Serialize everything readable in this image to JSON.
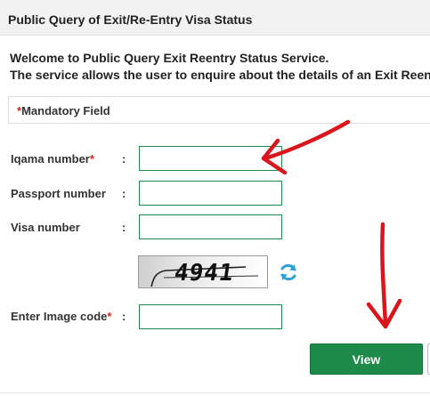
{
  "header": {
    "title": "Public Query of Exit/Re-Entry Visa Status"
  },
  "intro": {
    "line1": "Welcome to Public Query Exit Reentry Status Service.",
    "line2": "The service allows the user to enquire about the details of an Exit Reentry v"
  },
  "mandatory": {
    "asterisk": "*",
    "label": "Mandatory Field"
  },
  "form": {
    "iqama": {
      "label": "Iqama number",
      "required": "*",
      "colon": ":",
      "value": ""
    },
    "passport": {
      "label": "Passport number",
      "colon": ":",
      "value": ""
    },
    "visa": {
      "label": "Visa number",
      "colon": ":",
      "value": ""
    },
    "captcha": {
      "text": "4941"
    },
    "image_code": {
      "label": "Enter Image code",
      "required": "*",
      "colon": ":",
      "value": ""
    }
  },
  "actions": {
    "view_label": "View"
  },
  "colors": {
    "accent_green": "#1e8a4a",
    "required_red": "#d9241b",
    "annotation_red": "#d8161b",
    "refresh_blue": "#2aa0d8"
  }
}
